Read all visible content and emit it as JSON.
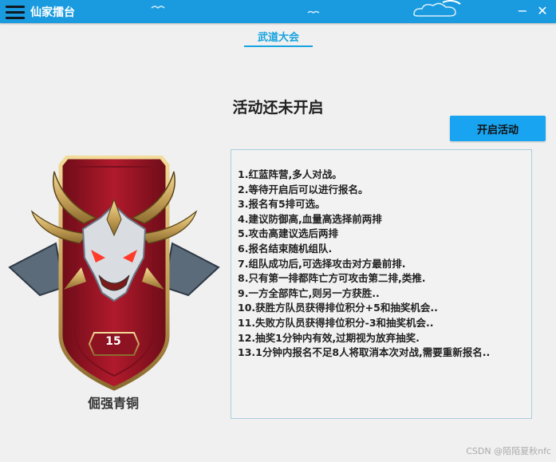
{
  "titlebar": {
    "title": "仙家擂台",
    "minimize_label": "−",
    "close_label": "✕"
  },
  "tabs": [
    {
      "label": "武道大会",
      "active": true
    }
  ],
  "status_text": "活动还未开启",
  "start_button_label": "开启活动",
  "rules": [
    "1.红蓝阵营,多人对战。",
    "2.等待开启后可以进行报名。",
    "3.报名有5排可选。",
    "4.建议防御高,血量高选择前两排",
    "5.攻击高建议选后两排",
    "6.报名结束随机组队.",
    "7.组队成功后,可选择攻击对方最前排.",
    "8.只有第一排都阵亡方可攻击第二排,类推.",
    "9.一方全部阵亡,则另一方获胜..",
    "10.获胜方队员获得排位积分+5和抽奖机会..",
    "11.失败方队员获得排位积分-3和抽奖机会..",
    "12.抽奖1分钟内有效,过期视为放弃抽奖.",
    "13.1分钟内报名不足8人将取消本次对战,需要重新报名.."
  ],
  "badge": {
    "number": "15",
    "rank_title": "倔强青铜"
  },
  "watermark": "CSDN @陌陌夏秋nfc",
  "colors": {
    "titlebar": "#1a9be0",
    "accent": "#14a3e0",
    "button": "#18a4f0",
    "banner_red": "#9e1424",
    "gold": "#c9a45a"
  }
}
